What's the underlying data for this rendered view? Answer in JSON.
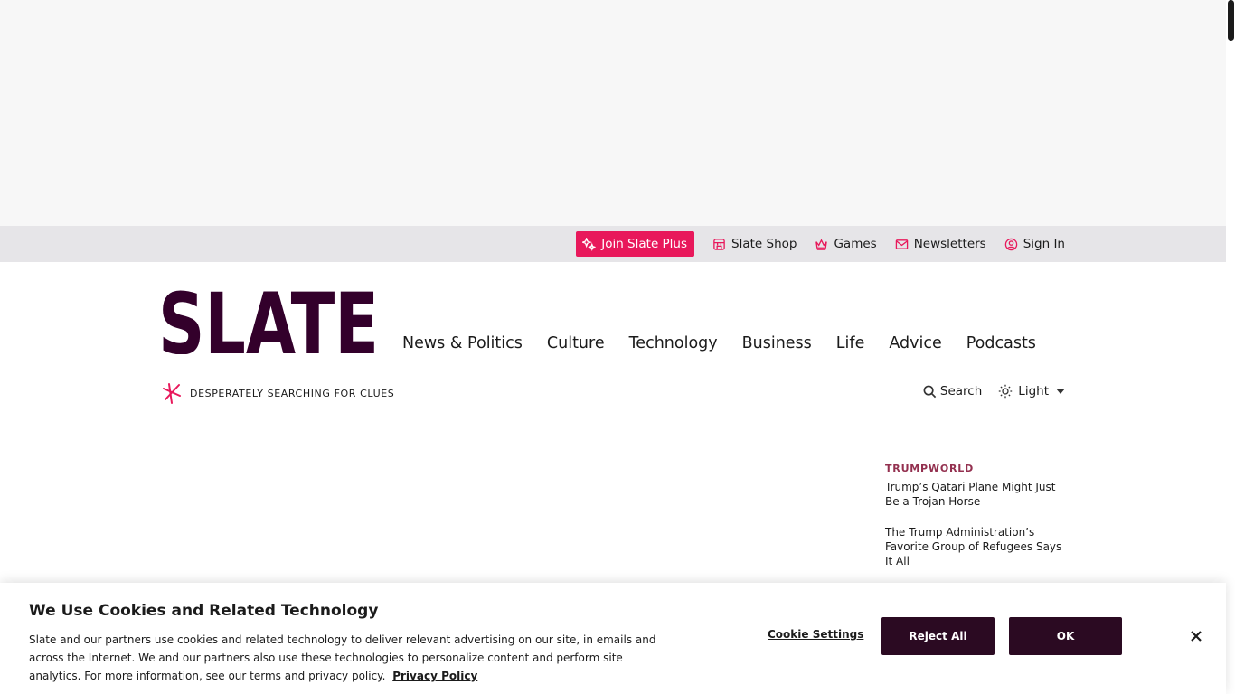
{
  "utility_bar": {
    "join": "Join Slate Plus",
    "shop": "Slate Shop",
    "games": "Games",
    "newsletters": "Newsletters",
    "signin": "Sign In"
  },
  "logo": {
    "label": "SLATE"
  },
  "nav": {
    "items": [
      "News & Politics",
      "Culture",
      "Technology",
      "Business",
      "Life",
      "Advice",
      "Podcasts"
    ]
  },
  "subbar": {
    "kicker": "DESPERATELY SEARCHING FOR CLUES",
    "search": "Search",
    "theme": "Light"
  },
  "rail": {
    "kicker": "TRUMPWORLD",
    "stories": [
      "Trump’s Qatari Plane Might Just Be a Trojan Horse",
      "The Trump Administration’s Favorite Group of Refugees Says It All"
    ]
  },
  "cookie": {
    "title": "We Use Cookies and Related Technology",
    "body": "Slate and our partners use cookies and related technology to deliver relevant advertising on our site, in emails and across the Internet. We and our partners also use these technologies to personalize content and perform site analytics. For more information, see our terms and privacy policy.",
    "policy_link": "Privacy Policy",
    "settings": "Cookie Settings",
    "reject": "Reject All",
    "ok": "OK"
  },
  "colors": {
    "accent": "#e8185b",
    "brand": "#33002b",
    "kicker": "#93304f",
    "button_dark": "#2b0a22"
  },
  "icons": {
    "join": "sparkle-icon",
    "shop": "shop-icon",
    "games": "crown-icon",
    "newsletters": "mail-icon",
    "signin": "user-icon",
    "search": "search-icon",
    "theme": "sun-icon",
    "close": "close-icon"
  }
}
